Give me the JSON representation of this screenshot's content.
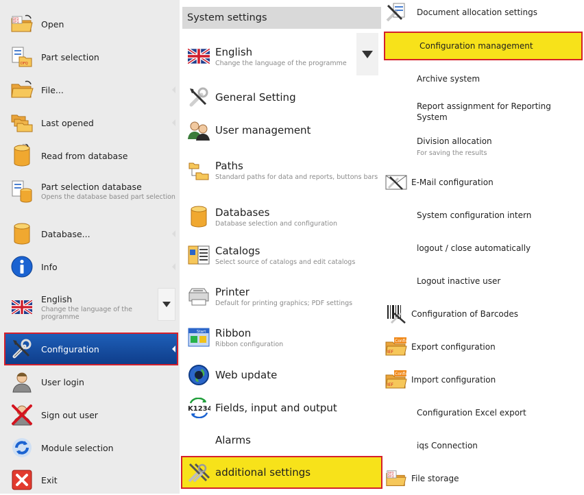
{
  "left_menu": {
    "items": [
      {
        "label": "Open",
        "icon": "folder-dfq-icon"
      },
      {
        "label": "Part selection",
        "icon": "part-selection-icon"
      },
      {
        "label": "File...",
        "icon": "folder-icon"
      },
      {
        "label": "Last opened",
        "icon": "stacked-folders-icon"
      },
      {
        "label": "Read from database",
        "icon": "database-icon"
      },
      {
        "label": "Part selection database",
        "sublabel": "Opens the database based part selection",
        "icon": "part-selection-database-icon"
      },
      {
        "label": "Database...",
        "icon": "database-icon"
      },
      {
        "label": "Info",
        "icon": "info-icon"
      },
      {
        "label": "English",
        "sublabel": "Change the language of the programme",
        "icon": "uk-flag-icon"
      },
      {
        "label": "Configuration",
        "icon": "tools-icon",
        "selected": true
      },
      {
        "label": "User login",
        "icon": "user-icon"
      },
      {
        "label": "Sign out user",
        "icon": "user-signout-icon"
      },
      {
        "label": "Module selection",
        "icon": "refresh-icon"
      },
      {
        "label": "Exit",
        "icon": "exit-icon"
      }
    ]
  },
  "system_settings": {
    "header": "System settings",
    "items": [
      {
        "label": "English",
        "sublabel": "Change the language of the programme",
        "icon": "uk-flag-icon"
      },
      {
        "label": "General Setting",
        "icon": "tools-icon"
      },
      {
        "label": "User management",
        "icon": "users-icon"
      },
      {
        "label": "Paths",
        "sublabel": "Standard paths for data and reports, buttons bars",
        "icon": "folder-tree-icon"
      },
      {
        "label": "Databases",
        "sublabel": "Database selection and configuration",
        "icon": "database-icon"
      },
      {
        "label": "Catalogs",
        "sublabel": "Select source of catalogs and edit catalogs",
        "icon": "catalog-icon"
      },
      {
        "label": "Printer",
        "sublabel": "Default for printing graphics; PDF settings",
        "icon": "printer-icon"
      },
      {
        "label": "Ribbon",
        "sublabel": "Ribbon configuration",
        "icon": "ribbon-icon"
      },
      {
        "label": "Web update",
        "icon": "globe-icon"
      },
      {
        "label": "Fields, input and output",
        "icon": "k1234-icon"
      },
      {
        "label": "Alarms",
        "icon": ""
      },
      {
        "label": "additional settings",
        "icon": "additional-tools-icon",
        "selected": true
      }
    ]
  },
  "configuration_options": {
    "items": [
      {
        "label": "Document allocation settings",
        "icon": "tools-document-icon"
      },
      {
        "label": "Configuration management",
        "selected": true
      },
      {
        "label": "Archive system"
      },
      {
        "label": "Report assignment for Reporting System"
      },
      {
        "label": "Division allocation",
        "sublabel": "For saving the results"
      },
      {
        "label": "E-Mail configuration",
        "icon": "email-tools-icon"
      },
      {
        "label": "System configuration intern"
      },
      {
        "label": "logout / close automatically"
      },
      {
        "label": "Logout inactive user"
      },
      {
        "label": "Configuration of Barcodes",
        "icon": "barcode-icon"
      },
      {
        "label": "Export configuration",
        "icon": "export-config-icon"
      },
      {
        "label": "Import configuration",
        "icon": "import-config-icon"
      },
      {
        "label": "Configuration Excel export"
      },
      {
        "label": "iqs Connection"
      },
      {
        "label": "File storage",
        "icon": "folder-dfq-icon"
      }
    ]
  },
  "colors": {
    "selected_blue": "#1e5fb8",
    "highlight_yellow": "#f7e21a",
    "selection_border": "#d4202b",
    "left_panel_bg": "#ebebeb",
    "header_bg": "#d9d9d9"
  }
}
